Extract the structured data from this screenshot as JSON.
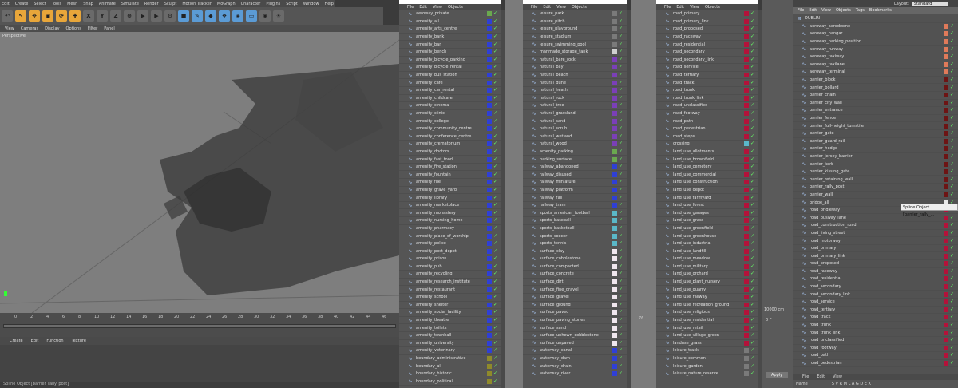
{
  "app": {
    "menu": [
      "Edit",
      "Create",
      "Select",
      "Tools",
      "Mesh",
      "Snap",
      "Animate",
      "Simulate",
      "Render",
      "Sculpt",
      "Motion Tracker",
      "MoGraph",
      "Character",
      "Plugins",
      "Script",
      "Window",
      "Help"
    ],
    "view_menu": [
      "View",
      "Cameras",
      "Display",
      "Options",
      "Filter",
      "Panel"
    ],
    "viewport_label": "Perspective",
    "toolbar_icons": [
      "move-icon",
      "scale-icon",
      "rotate-icon",
      "x-axis-icon",
      "y-axis-icon",
      "z-axis-icon",
      "coordinate-icon",
      "render-icon",
      "render-settings-icon",
      "cube-icon",
      "pen-icon",
      "subdivision-icon",
      "array-icon",
      "deformer-icon",
      "floor-icon",
      "camera-icon",
      "light-icon"
    ],
    "toolbar_letters": [
      "X",
      "Y",
      "Z"
    ],
    "timeline": {
      "ticks": [
        "0",
        "2",
        "4",
        "6",
        "8",
        "10",
        "12",
        "14",
        "16",
        "18",
        "20",
        "22",
        "24",
        "26",
        "28",
        "30",
        "32",
        "34",
        "36",
        "38",
        "40",
        "42",
        "44",
        "46"
      ],
      "frame_left": "0 F",
      "frame_right": "76",
      "distance": "10000 cm"
    },
    "material_menu": [
      "Create",
      "Edit",
      "Function",
      "Texture"
    ],
    "status_text": "Spline Object [barrier_rally_post]",
    "layout_label": "Layout:",
    "layout_value": "Standard",
    "apply_label": "Apply",
    "tooltip": "Spline Object [barrier_rally_..."
  },
  "object_menu": [
    "File",
    "Edit",
    "View",
    "Objects"
  ],
  "right_menu": [
    "File",
    "Edit",
    "View",
    "Objects",
    "Tags",
    "Bookmarks"
  ],
  "bottom_tabs": [
    "File",
    "Edit",
    "View"
  ],
  "bottom_columns": [
    "Name",
    "S V R M L A G D E X"
  ],
  "panels": [
    {
      "items": [
        {
          "label": "aeroway_private",
          "color": "#6aa84f"
        },
        {
          "label": "amenity_all",
          "color": "#2f3fd6"
        },
        {
          "label": "amenity_arts_centre",
          "color": "#2f3fd6"
        },
        {
          "label": "amenity_bank",
          "color": "#2f3fd6"
        },
        {
          "label": "amenity_bar",
          "color": "#2f3fd6"
        },
        {
          "label": "amenity_bench",
          "color": "#2f3fd6"
        },
        {
          "label": "amenity_bicycle_parking",
          "color": "#2f3fd6"
        },
        {
          "label": "amenity_bicycle_rental",
          "color": "#2f3fd6"
        },
        {
          "label": "amenity_bus_station",
          "color": "#2f3fd6"
        },
        {
          "label": "amenity_cafe",
          "color": "#2f3fd6"
        },
        {
          "label": "amenity_car_rental",
          "color": "#2f3fd6"
        },
        {
          "label": "amenity_childcare",
          "color": "#2f3fd6"
        },
        {
          "label": "amenity_cinema",
          "color": "#2f3fd6"
        },
        {
          "label": "amenity_clinic",
          "color": "#2f3fd6"
        },
        {
          "label": "amenity_college",
          "color": "#2f3fd6"
        },
        {
          "label": "amenity_community_centre",
          "color": "#2f3fd6"
        },
        {
          "label": "amenity_conference_centre",
          "color": "#2f3fd6"
        },
        {
          "label": "amenity_crematorium",
          "color": "#2f3fd6"
        },
        {
          "label": "amenity_doctors",
          "color": "#2f3fd6"
        },
        {
          "label": "amenity_fast_food",
          "color": "#2f3fd6"
        },
        {
          "label": "amenity_fire_station",
          "color": "#2f3fd6"
        },
        {
          "label": "amenity_fountain",
          "color": "#2f3fd6"
        },
        {
          "label": "amenity_fuel",
          "color": "#2f3fd6"
        },
        {
          "label": "amenity_grave_yard",
          "color": "#2f3fd6"
        },
        {
          "label": "amenity_library",
          "color": "#2f3fd6"
        },
        {
          "label": "amenity_marketplace",
          "color": "#2f3fd6"
        },
        {
          "label": "amenity_monastery",
          "color": "#2f3fd6"
        },
        {
          "label": "amenity_nursing_home",
          "color": "#2f3fd6"
        },
        {
          "label": "amenity_pharmacy",
          "color": "#2f3fd6"
        },
        {
          "label": "amenity_place_of_worship",
          "color": "#2f3fd6"
        },
        {
          "label": "amenity_police",
          "color": "#2f3fd6"
        },
        {
          "label": "amenity_post_depot",
          "color": "#2f3fd6"
        },
        {
          "label": "amenity_prison",
          "color": "#2f3fd6"
        },
        {
          "label": "amenity_pub",
          "color": "#2f3fd6"
        },
        {
          "label": "amenity_recycling",
          "color": "#2f3fd6"
        },
        {
          "label": "amenity_research_institute",
          "color": "#2f3fd6"
        },
        {
          "label": "amenity_restaurant",
          "color": "#2f3fd6"
        },
        {
          "label": "amenity_school",
          "color": "#2f3fd6"
        },
        {
          "label": "amenity_shelter",
          "color": "#2f3fd6"
        },
        {
          "label": "amenity_social_facility",
          "color": "#2f3fd6"
        },
        {
          "label": "amenity_theatre",
          "color": "#2f3fd6"
        },
        {
          "label": "amenity_toilets",
          "color": "#2f3fd6"
        },
        {
          "label": "amenity_townhall",
          "color": "#2f3fd6"
        },
        {
          "label": "amenity_university",
          "color": "#2f3fd6"
        },
        {
          "label": "amenity_veterinary",
          "color": "#2f3fd6"
        },
        {
          "label": "boundary_administrative",
          "color": "#8f8a2a"
        },
        {
          "label": "boundary_all",
          "color": "#8f8a2a"
        },
        {
          "label": "boundary_historic",
          "color": "#8f8a2a"
        },
        {
          "label": "boundary_political",
          "color": "#8f8a2a"
        }
      ]
    },
    {
      "items": [
        {
          "label": "leisure_park",
          "color": "#7a7a7a"
        },
        {
          "label": "leisure_pitch",
          "color": "#7a7a7a"
        },
        {
          "label": "leisure_playground",
          "color": "#7a7a7a"
        },
        {
          "label": "leisure_stadium",
          "color": "#7a7a7a"
        },
        {
          "label": "leisure_swimming_pool",
          "color": "#7a7a7a"
        },
        {
          "label": "manmade_storage_tank",
          "color": "#cfcfcf"
        },
        {
          "label": "natural_bare_rock",
          "color": "#7b3fb8"
        },
        {
          "label": "natural_bay",
          "color": "#7b3fb8"
        },
        {
          "label": "natural_beach",
          "color": "#7b3fb8"
        },
        {
          "label": "natural_dune",
          "color": "#7b3fb8"
        },
        {
          "label": "natural_heath",
          "color": "#7b3fb8"
        },
        {
          "label": "natural_rock",
          "color": "#7b3fb8"
        },
        {
          "label": "natural_tree",
          "color": "#7b3fb8"
        },
        {
          "label": "natural_grassland",
          "color": "#7b3fb8"
        },
        {
          "label": "natural_sand",
          "color": "#7b3fb8"
        },
        {
          "label": "natural_scrub",
          "color": "#7b3fb8"
        },
        {
          "label": "natural_wetland",
          "color": "#7b3fb8"
        },
        {
          "label": "natural_wood",
          "color": "#7b3fb8"
        },
        {
          "label": "amenity_parking",
          "color": "#6aa84f"
        },
        {
          "label": "parking_surface",
          "color": "#6aa84f"
        },
        {
          "label": "railway_abandoned",
          "color": "#2f3fd6"
        },
        {
          "label": "railway_disused",
          "color": "#2f3fd6"
        },
        {
          "label": "railway_miniature",
          "color": "#2f3fd6"
        },
        {
          "label": "railway_platform",
          "color": "#2f3fd6"
        },
        {
          "label": "railway_rail",
          "color": "#2f3fd6"
        },
        {
          "label": "railway_tram",
          "color": "#2f3fd6"
        },
        {
          "label": "sports_american_football",
          "color": "#5ab8c9"
        },
        {
          "label": "sports_baseball",
          "color": "#5ab8c9"
        },
        {
          "label": "sports_basketball",
          "color": "#5ab8c9"
        },
        {
          "label": "sports_soccer",
          "color": "#5ab8c9"
        },
        {
          "label": "sports_tennis",
          "color": "#5ab8c9"
        },
        {
          "label": "surface_clay",
          "color": "#f0e6ee"
        },
        {
          "label": "surface_cobblestone",
          "color": "#f0e6ee"
        },
        {
          "label": "surface_compacted",
          "color": "#f0e6ee"
        },
        {
          "label": "surface_concrete",
          "color": "#f0e6ee"
        },
        {
          "label": "surface_dirt",
          "color": "#f0e6ee"
        },
        {
          "label": "surface_fine_gravel",
          "color": "#f0e6ee"
        },
        {
          "label": "surface_gravel",
          "color": "#f0e6ee"
        },
        {
          "label": "surface_ground",
          "color": "#f0e6ee"
        },
        {
          "label": "surface_paved",
          "color": "#f0e6ee"
        },
        {
          "label": "surface_paving_stones",
          "color": "#f0e6ee"
        },
        {
          "label": "surface_sand",
          "color": "#f0e6ee"
        },
        {
          "label": "surface_unhewn_cobblestone",
          "color": "#f0e6ee"
        },
        {
          "label": "surface_unpaved",
          "color": "#f0e6ee"
        },
        {
          "label": "waterway_canal",
          "color": "#2f3fd6"
        },
        {
          "label": "waterway_dam",
          "color": "#2f3fd6"
        },
        {
          "label": "waterway_drain",
          "color": "#2f3fd6"
        },
        {
          "label": "waterway_river",
          "color": "#2f3fd6"
        }
      ]
    },
    {
      "items": [
        {
          "label": "road_primary",
          "color": "#b3123a"
        },
        {
          "label": "road_primary_link",
          "color": "#b3123a"
        },
        {
          "label": "road_proposed",
          "color": "#b3123a"
        },
        {
          "label": "road_raceway",
          "color": "#b3123a"
        },
        {
          "label": "road_residential",
          "color": "#b3123a"
        },
        {
          "label": "road_secondary",
          "color": "#b3123a"
        },
        {
          "label": "road_secondary_link",
          "color": "#b3123a"
        },
        {
          "label": "road_service",
          "color": "#b3123a"
        },
        {
          "label": "road_tertiary",
          "color": "#b3123a"
        },
        {
          "label": "road_track",
          "color": "#b3123a"
        },
        {
          "label": "road_trunk",
          "color": "#b3123a"
        },
        {
          "label": "road_trunk_link",
          "color": "#b3123a"
        },
        {
          "label": "road_unclassified",
          "color": "#b3123a"
        },
        {
          "label": "road_footway",
          "color": "#b3123a"
        },
        {
          "label": "road_path",
          "color": "#b3123a"
        },
        {
          "label": "road_pedestrian",
          "color": "#b3123a"
        },
        {
          "label": "road_steps",
          "color": "#b3123a"
        },
        {
          "label": "crossing",
          "color": "#5ab8c9"
        },
        {
          "label": "land_use_allotments",
          "color": "#b3123a"
        },
        {
          "label": "land_use_brownfield",
          "color": "#b3123a"
        },
        {
          "label": "land_use_cemetery",
          "color": "#b3123a"
        },
        {
          "label": "land_use_commercial",
          "color": "#b3123a"
        },
        {
          "label": "land_use_construction",
          "color": "#b3123a"
        },
        {
          "label": "land_use_depot",
          "color": "#b3123a"
        },
        {
          "label": "land_use_farmyard",
          "color": "#b3123a"
        },
        {
          "label": "land_use_forest",
          "color": "#b3123a"
        },
        {
          "label": "land_use_garages",
          "color": "#b3123a"
        },
        {
          "label": "land_use_grass",
          "color": "#b3123a"
        },
        {
          "label": "land_use_greenfield",
          "color": "#b3123a"
        },
        {
          "label": "land_use_greenhouse",
          "color": "#b3123a"
        },
        {
          "label": "land_use_industrial",
          "color": "#b3123a"
        },
        {
          "label": "land_use_landfill",
          "color": "#b3123a"
        },
        {
          "label": "land_use_meadow",
          "color": "#b3123a"
        },
        {
          "label": "land_use_military",
          "color": "#b3123a"
        },
        {
          "label": "land_use_orchard",
          "color": "#b3123a"
        },
        {
          "label": "land_use_plant_nursery",
          "color": "#b3123a"
        },
        {
          "label": "land_use_quarry",
          "color": "#b3123a"
        },
        {
          "label": "land_use_railway",
          "color": "#b3123a"
        },
        {
          "label": "land_use_recreation_ground",
          "color": "#b3123a"
        },
        {
          "label": "land_use_religious",
          "color": "#b3123a"
        },
        {
          "label": "land_use_residential",
          "color": "#b3123a"
        },
        {
          "label": "land_use_retail",
          "color": "#b3123a"
        },
        {
          "label": "land_use_village_green",
          "color": "#b3123a"
        },
        {
          "label": "landuse_grass",
          "color": "#b3123a"
        },
        {
          "label": "leisure_track",
          "color": "#7a7a7a"
        },
        {
          "label": "leisure_common",
          "color": "#7a7a7a"
        },
        {
          "label": "leisure_garden",
          "color": "#7a7a7a"
        },
        {
          "label": "leisure_nature_reserve",
          "color": "#7a7a7a"
        }
      ]
    },
    {
      "root": "DUBLIN",
      "items": [
        {
          "label": "aeroway_aerodrome",
          "color": "#e07a5a"
        },
        {
          "label": "aeroway_hangar",
          "color": "#e07a5a"
        },
        {
          "label": "aeroway_parking_position",
          "color": "#e07a5a"
        },
        {
          "label": "aeroway_runway",
          "color": "#e07a5a"
        },
        {
          "label": "aeroway_taxiway",
          "color": "#e07a5a"
        },
        {
          "label": "aeroway_taxilane",
          "color": "#e07a5a"
        },
        {
          "label": "aeroway_terminal",
          "color": "#e07a5a"
        },
        {
          "label": "barrier_block",
          "color": "#6d1414"
        },
        {
          "label": "barrier_bollard",
          "color": "#6d1414"
        },
        {
          "label": "barrier_chain",
          "color": "#6d1414"
        },
        {
          "label": "barrier_city_wall",
          "color": "#6d1414"
        },
        {
          "label": "barrier_entrance",
          "color": "#6d1414"
        },
        {
          "label": "barrier_fence",
          "color": "#6d1414"
        },
        {
          "label": "barrier_full-height_turnstile",
          "color": "#6d1414"
        },
        {
          "label": "barrier_gate",
          "color": "#6d1414"
        },
        {
          "label": "barrier_guard_rail",
          "color": "#6d1414"
        },
        {
          "label": "barrier_hedge",
          "color": "#6d1414"
        },
        {
          "label": "barrier_jersey_barrier",
          "color": "#6d1414"
        },
        {
          "label": "barrier_kerb",
          "color": "#6d1414"
        },
        {
          "label": "barrier_kissing_gate",
          "color": "#6d1414"
        },
        {
          "label": "barrier_retaining_wall",
          "color": "#6d1414"
        },
        {
          "label": "barrier_rally_post",
          "color": "#6d1414"
        },
        {
          "label": "barrier_wall",
          "color": "#6d1414"
        },
        {
          "label": "bridge_all",
          "color": "#e8e8e8"
        },
        {
          "label": "road_bridleway",
          "color": "#b3123a"
        },
        {
          "label": "road_busway_lane",
          "color": "#b3123a"
        },
        {
          "label": "road_construction_road",
          "color": "#b3123a"
        },
        {
          "label": "road_living_street",
          "color": "#b3123a"
        },
        {
          "label": "road_motorway",
          "color": "#b3123a"
        },
        {
          "label": "road_primary",
          "color": "#b3123a"
        },
        {
          "label": "road_primary_link",
          "color": "#b3123a"
        },
        {
          "label": "road_proposed",
          "color": "#b3123a"
        },
        {
          "label": "road_raceway",
          "color": "#b3123a"
        },
        {
          "label": "road_residential",
          "color": "#b3123a"
        },
        {
          "label": "road_secondary",
          "color": "#b3123a"
        },
        {
          "label": "road_secondary_link",
          "color": "#b3123a"
        },
        {
          "label": "road_service",
          "color": "#b3123a"
        },
        {
          "label": "road_tertiary",
          "color": "#b3123a"
        },
        {
          "label": "road_track",
          "color": "#b3123a"
        },
        {
          "label": "road_trunk",
          "color": "#b3123a"
        },
        {
          "label": "road_trunk_link",
          "color": "#b3123a"
        },
        {
          "label": "road_unclassified",
          "color": "#b3123a"
        },
        {
          "label": "road_footway",
          "color": "#b3123a"
        },
        {
          "label": "road_path",
          "color": "#b3123a"
        },
        {
          "label": "road_pedestrian",
          "color": "#b3123a"
        }
      ]
    }
  ]
}
